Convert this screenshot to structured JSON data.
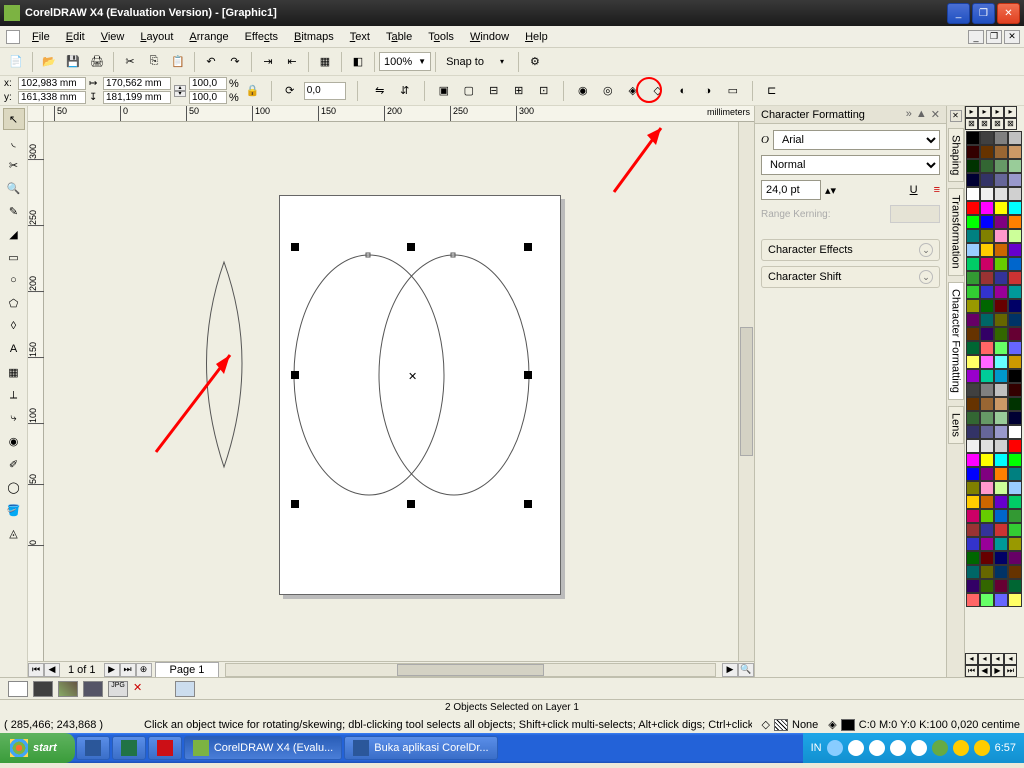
{
  "titlebar": {
    "title": "CorelDRAW X4 (Evaluation Version) - [Graphic1]"
  },
  "menubar": {
    "file": "File",
    "edit": "Edit",
    "view": "View",
    "layout": "Layout",
    "arrange": "Arrange",
    "effects": "Effects",
    "bitmaps": "Bitmaps",
    "text": "Text",
    "table": "Table",
    "tools": "Tools",
    "window": "Window",
    "help": "Help"
  },
  "toolbar1": {
    "zoom": "100%",
    "snapto": "Snap to"
  },
  "propbar": {
    "x_label": "x:",
    "y_label": "y:",
    "x": "102,983 mm",
    "y": "161,338 mm",
    "w": "170,562 mm",
    "h": "181,199 mm",
    "sx": "100,0",
    "sy": "100,0",
    "pct": "%",
    "rot": "0,0"
  },
  "hruler": {
    "unit": "millimeters",
    "ticks": [
      "50",
      "0",
      "50",
      "100",
      "150",
      "200",
      "250",
      "300"
    ]
  },
  "vruler": {
    "ticks": [
      "300",
      "250",
      "200",
      "150",
      "100",
      "50",
      "0"
    ]
  },
  "pagebar": {
    "count": "1 of 1",
    "tab": "Page 1"
  },
  "docker": {
    "title": "Character Formatting",
    "font": "Arial",
    "style": "Normal",
    "size": "24,0 pt",
    "range": "Range Kerning:",
    "effects": "Character Effects",
    "shift": "Character Shift",
    "tab_shaping": "Shaping",
    "tab_transform": "Transformation",
    "tab_char": "Character Formatting",
    "tab_lens": "Lens"
  },
  "status1": "2 Objects Selected on Layer 1",
  "status2": {
    "coords": "( 285,466; 243,868 )",
    "hint": "Click an object twice for rotating/skewing; dbl-clicking tool selects all objects; Shift+click multi-selects; Alt+click digs; Ctrl+click selects in a group",
    "fill_none": "None",
    "outline": "C:0 M:0 Y:0 K:100  0,020 centime"
  },
  "taskbar": {
    "start": "start",
    "app1": "CorelDRAW X4 (Evalu...",
    "app2": "Buka aplikasi CorelDr...",
    "lang": "IN",
    "clock": "6:57"
  },
  "colors": [
    "#000000",
    "#404040",
    "#808080",
    "#c0c0c0",
    "#330000",
    "#663300",
    "#996633",
    "#cc9966",
    "#003300",
    "#336633",
    "#669966",
    "#99cc99",
    "#000033",
    "#333366",
    "#666699",
    "#9999cc",
    "#ffffff",
    "#f0f0f0",
    "#e0e0e0",
    "#d0d0d0",
    "#ff0000",
    "#ff00ff",
    "#ffff00",
    "#00ffff",
    "#00ff00",
    "#0000ff",
    "#800080",
    "#ff8000",
    "#008080",
    "#808000",
    "#ff99cc",
    "#ccff99",
    "#99ccff",
    "#ffcc00",
    "#cc6600",
    "#6600cc",
    "#00cc66",
    "#cc0066",
    "#66cc00",
    "#0066cc",
    "#339933",
    "#993333",
    "#333399",
    "#cc3333",
    "#33cc33",
    "#3333cc",
    "#990099",
    "#009999",
    "#999900",
    "#006600",
    "#660000",
    "#000066",
    "#660066",
    "#006666",
    "#666600",
    "#003366",
    "#663300",
    "#330066",
    "#336600",
    "#660033",
    "#006633",
    "#ff6666",
    "#66ff66",
    "#6666ff",
    "#ffff66",
    "#ff66ff",
    "#66ffff",
    "#cc9900",
    "#9900cc",
    "#00cc99",
    "#0099cc"
  ]
}
